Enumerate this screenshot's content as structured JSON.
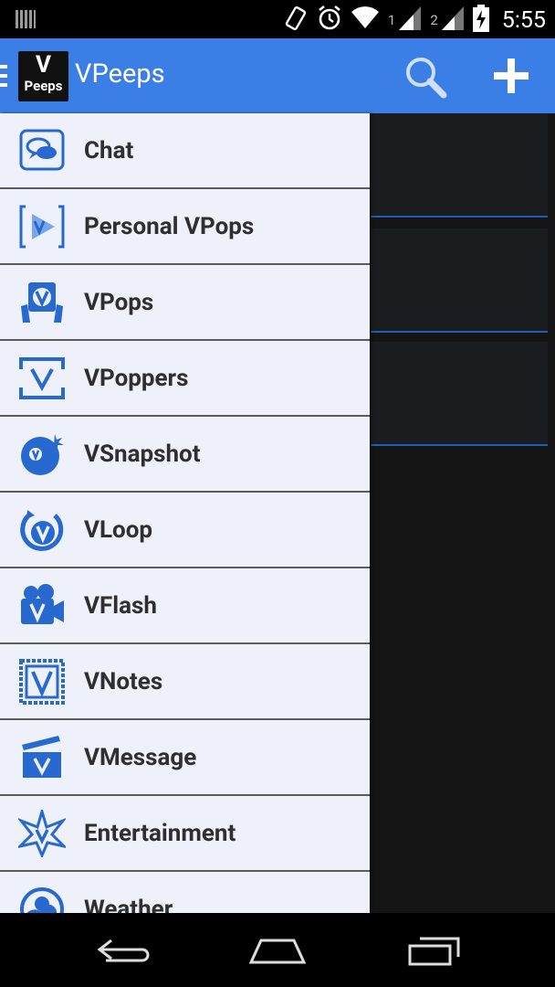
{
  "status_bar": {
    "sim1": "1",
    "sim2": "2",
    "time": "5:55"
  },
  "action_bar": {
    "logo_line1": "V",
    "logo_line2": "Peeps",
    "title": "VPeeps",
    "background": "#3a7ee6"
  },
  "drawer": {
    "accent": "#2769cf",
    "items": [
      {
        "label": "Chat",
        "icon": "chat-icon"
      },
      {
        "label": "Personal VPops",
        "icon": "play-icon"
      },
      {
        "label": "VPops",
        "icon": "vpops-icon"
      },
      {
        "label": "VPoppers",
        "icon": "vpoppers-icon"
      },
      {
        "label": "VSnapshot",
        "icon": "snapshot-icon"
      },
      {
        "label": "VLoop",
        "icon": "loop-icon"
      },
      {
        "label": "VFlash",
        "icon": "camera-icon"
      },
      {
        "label": "VNotes",
        "icon": "notes-icon"
      },
      {
        "label": "VMessage",
        "icon": "message-icon"
      },
      {
        "label": "Entertainment",
        "icon": "star-icon"
      },
      {
        "label": "Weather",
        "icon": "weather-icon"
      }
    ]
  }
}
